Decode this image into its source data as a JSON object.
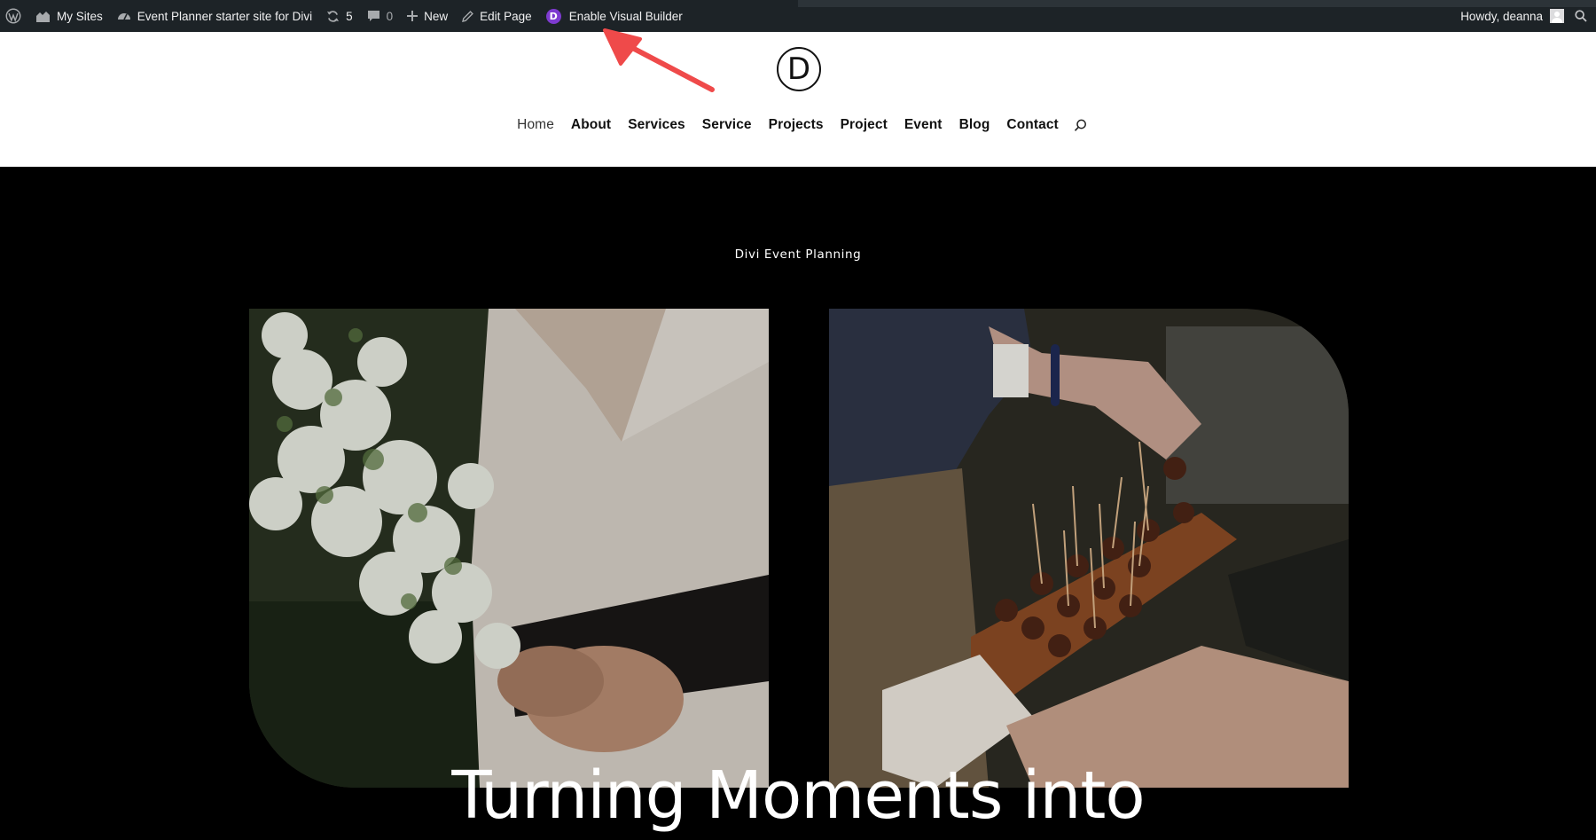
{
  "admin_bar": {
    "my_sites": "My Sites",
    "site_name": "Event Planner starter site for Divi",
    "updates_count": "5",
    "comments_count": "0",
    "new_label": "New",
    "edit_page_label": "Edit Page",
    "divi_badge": "D",
    "visual_builder_label": "Enable Visual Builder",
    "greeting": "Howdy, deanna"
  },
  "header": {
    "logo_letter": "D",
    "nav": [
      "Home",
      "About",
      "Services",
      "Service",
      "Projects",
      "Project",
      "Event",
      "Blog",
      "Contact"
    ]
  },
  "hero": {
    "eyebrow": "Divi Event Planning",
    "title": "Turning Moments into"
  },
  "colors": {
    "admin_bar_bg": "#1d2327",
    "divi_purple": "#7e3bd0",
    "annotation_red": "#ef4a4a",
    "hero_bg": "#000000"
  }
}
